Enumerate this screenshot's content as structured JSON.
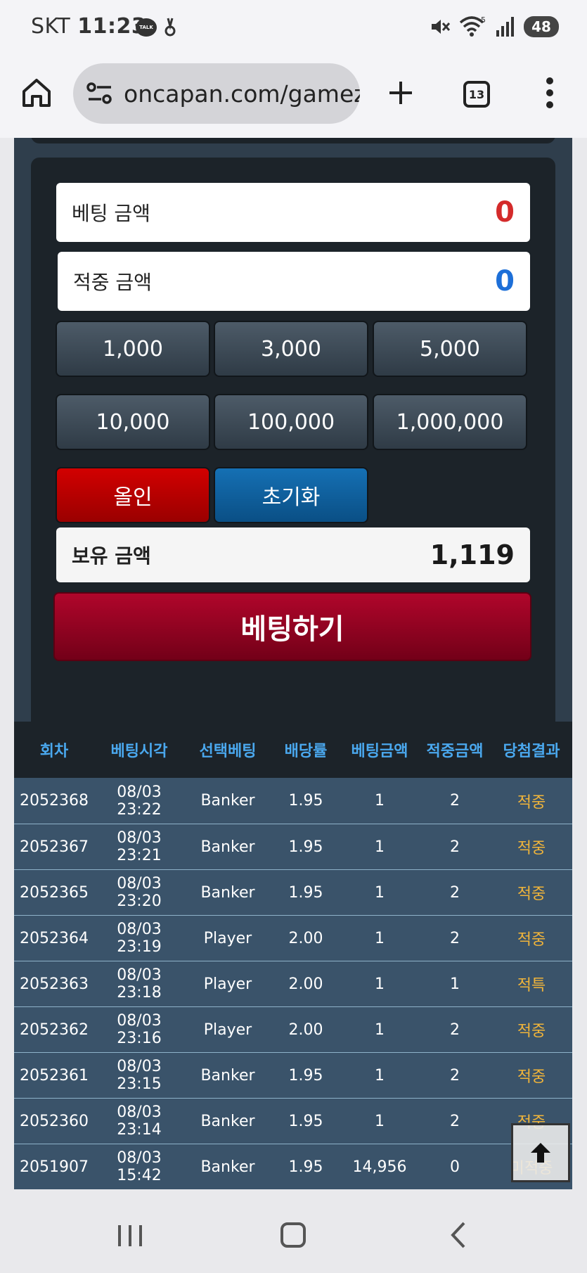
{
  "status_bar": {
    "carrier": "SKT",
    "time": "11:23",
    "talk_icon_text": "TALK",
    "wifi_badge": "5",
    "battery": "48"
  },
  "browser": {
    "url": "oncapan.com/gamez",
    "tab_count": "13"
  },
  "bet_panel": {
    "bet_amount_label": "베팅 금액",
    "bet_amount_value": "0",
    "win_amount_label": "적중 금액",
    "win_amount_value": "0",
    "amount_buttons": [
      "1,000",
      "3,000",
      "5,000",
      "10,000",
      "100,000",
      "1,000,000"
    ],
    "allin_label": "올인",
    "reset_label": "초기화",
    "hold_label": "보유 금액",
    "hold_value": "1,119",
    "bet_button_label": "베팅하기"
  },
  "history": {
    "columns": [
      "회차",
      "베팅시각",
      "선택베팅",
      "배당률",
      "베팅금액",
      "적중금액",
      "당첨결과"
    ],
    "rows": [
      [
        "2052368",
        "08/03 23:22",
        "Banker",
        "1.95",
        "1",
        "2",
        "적중"
      ],
      [
        "2052367",
        "08/03 23:21",
        "Banker",
        "1.95",
        "1",
        "2",
        "적중"
      ],
      [
        "2052365",
        "08/03 23:20",
        "Banker",
        "1.95",
        "1",
        "2",
        "적중"
      ],
      [
        "2052364",
        "08/03 23:19",
        "Player",
        "2.00",
        "1",
        "2",
        "적중"
      ],
      [
        "2052363",
        "08/03 23:18",
        "Player",
        "2.00",
        "1",
        "1",
        "적특"
      ],
      [
        "2052362",
        "08/03 23:16",
        "Player",
        "2.00",
        "1",
        "2",
        "적중"
      ],
      [
        "2052361",
        "08/03 23:15",
        "Banker",
        "1.95",
        "1",
        "2",
        "적중"
      ],
      [
        "2052360",
        "08/03 23:14",
        "Banker",
        "1.95",
        "1",
        "2",
        "적중"
      ],
      [
        "2051907",
        "08/03 15:42",
        "Banker",
        "1.95",
        "14,956",
        "0",
        "미적중"
      ]
    ]
  },
  "colors": {
    "panel_bg": "#1c2329",
    "panel_outer": "#2f3e4c",
    "bet_value_red": "#d42b2b",
    "win_value_blue": "#1d6fd8",
    "header_text": "#4aa8ee",
    "result_text": "#f0b43a",
    "bet_button": "#a00624"
  },
  "icons": [
    "home-icon",
    "tune-icon",
    "plus-icon",
    "more-icon",
    "arrow-up-icon",
    "recents-icon",
    "nav-home-icon",
    "back-icon",
    "mute-icon",
    "wifi-icon",
    "signal-icon"
  ]
}
